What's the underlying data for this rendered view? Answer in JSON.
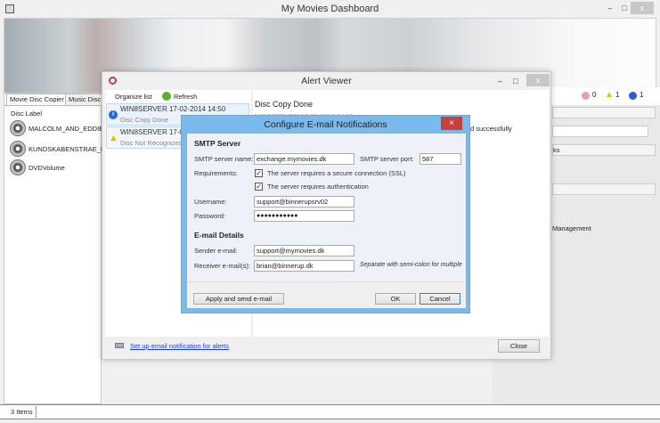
{
  "main_window": {
    "title": "My Movies Dashboard",
    "minimize": "–",
    "maximize": "□",
    "close": "x"
  },
  "left_panel": {
    "tabs": [
      "Movie Disc Copier",
      "Music Disc C"
    ],
    "column_header": "Disc Label",
    "discs": [
      "MALCOLM_AND_EDDIE_",
      "KUNDSKABENSTRAE_DVD",
      "DVDVolume"
    ]
  },
  "right_panel": {
    "status_counts": {
      "errors": "0",
      "warnings": "1",
      "info": "1"
    },
    "partial_text_1": "ks",
    "partial_text_2": "Management"
  },
  "status_bar": {
    "items": "3 Items"
  },
  "alert_viewer": {
    "title": "Alert Viewer",
    "organize_label": "Organize list",
    "refresh_label": "Refresh",
    "alerts": [
      {
        "title": "WIN8SERVER 17-02-2014 14:50",
        "subtitle": "Disc Copy Done",
        "type": "info"
      },
      {
        "title": "WIN8SERVER 17-02-",
        "subtitle": "Disc Not Recognized",
        "type": "warning"
      }
    ],
    "detail": {
      "heading": "Disc Copy Done",
      "meta": "WIN8SERVER 17-02-2014 14:50",
      "message_partial": "d successfully"
    },
    "email_link": "Set up email notification for alerts",
    "close_label": "Close"
  },
  "email_dialog": {
    "title": "Configure E-mail Notifications",
    "close": "×",
    "smtp_heading": "SMTP Server",
    "server_name_label": "SMTP server name:",
    "server_name": "exchange.mymovies.dk",
    "port_label": "SMTP server port:",
    "port": "587",
    "requirements_label": "Requirements:",
    "ssl_label": "The server requires a secure connection (SSL)",
    "ssl_checked": true,
    "auth_label": "The server requires authentication",
    "auth_checked": true,
    "username_label": "Username:",
    "username": "support@binnerupsrv02",
    "password_label": "Password:",
    "password": "●●●●●●●●●●●",
    "details_heading": "E-mail Details",
    "sender_label": "Sender e-mail:",
    "sender": "support@mymovies.dk",
    "receiver_label": "Receiver e-mail(s):",
    "receiver": "brian@binnerup.dk",
    "receiver_hint": "Separate with semi-colon for multiple",
    "apply_label": "Apply and send e-mail",
    "ok_label": "OK",
    "cancel_label": "Cancel"
  }
}
